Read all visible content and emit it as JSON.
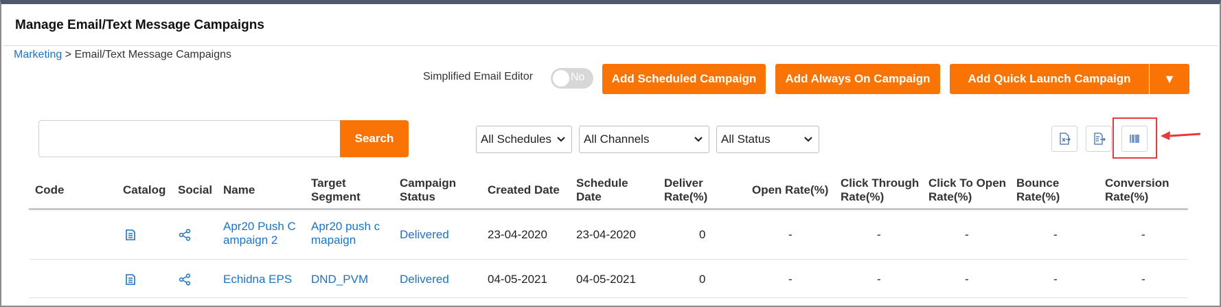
{
  "page_title": "Manage Email/Text Message Campaigns",
  "breadcrumb": {
    "parent": "Marketing",
    "separator": " > ",
    "current": "Email/Text Message Campaigns"
  },
  "editor_toggle": {
    "label": "Simplified Email Editor",
    "state": "No"
  },
  "buttons": {
    "add_scheduled": "Add Scheduled Campaign",
    "add_always_on": "Add Always On Campaign",
    "add_quick_launch": "Add Quick Launch Campaign",
    "dropdown_caret": "▼"
  },
  "search": {
    "placeholder": "",
    "button_label": "Search"
  },
  "filters": {
    "schedules": "All Schedules",
    "channels": "All Channels",
    "status": "All Status"
  },
  "toolbar_icons": [
    "excel-export-icon",
    "export-icon",
    "column-settings-icon"
  ],
  "colors": {
    "accent": "#f97305",
    "link": "#1a73c7",
    "highlight": "#e53b3b"
  },
  "table": {
    "headers": {
      "code": "Code",
      "catalog": "Catalog",
      "social": "Social",
      "name": "Name",
      "target_segment_1": "Target",
      "target_segment_2": "Segment",
      "campaign_status_1": "Campaign",
      "campaign_status_2": "Status",
      "created_date": "Created Date",
      "schedule_date_1": "Schedule",
      "schedule_date_2": "Date",
      "deliver_rate_1": "Deliver",
      "deliver_rate_2": "Rate(%)",
      "open_rate": "Open Rate(%)",
      "click_through_1": "Click Through",
      "click_through_2": "Rate(%)",
      "click_to_open_1": "Click To Open",
      "click_to_open_2": "Rate(%)",
      "bounce_1": "Bounce",
      "bounce_2": "Rate(%)",
      "conversion_1": "Conversion",
      "conversion_2": "Rate(%)"
    },
    "rows": [
      {
        "code": "",
        "name_1": "Apr20 Push C",
        "name_2": "ampaign 2",
        "segment_1": "Apr20 push c",
        "segment_2": "mapaign",
        "status": "Delivered",
        "created": "23-04-2020",
        "scheduled": "23-04-2020",
        "deliver": "0",
        "open": "-",
        "click_through": "-",
        "click_to_open": "-",
        "bounce": "-",
        "conversion": "-"
      },
      {
        "code": "",
        "name_1": "Echidna EPS",
        "name_2": "",
        "segment_1": "DND_PVM",
        "segment_2": "",
        "status": "Delivered",
        "created": "04-05-2021",
        "scheduled": "04-05-2021",
        "deliver": "0",
        "open": "-",
        "click_through": "-",
        "click_to_open": "-",
        "bounce": "-",
        "conversion": "-"
      }
    ]
  }
}
